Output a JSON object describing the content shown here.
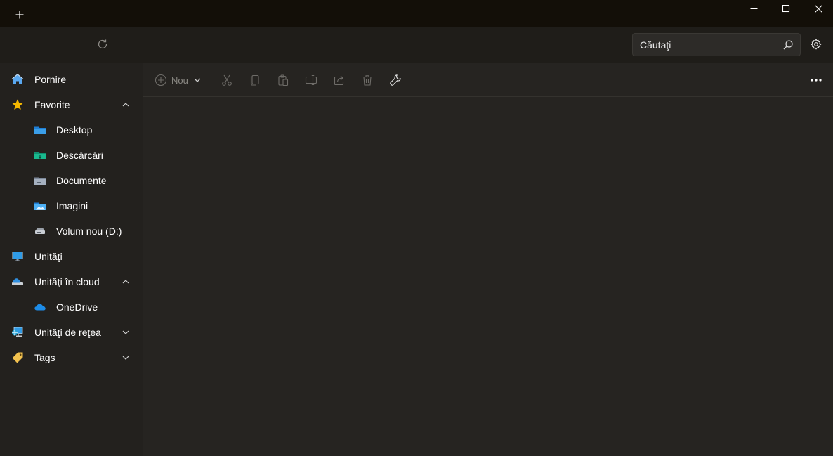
{
  "titlebar": {
    "new_tab_icon": "plus-icon",
    "minimize_icon": "minimize-icon",
    "maximize_icon": "maximize-icon",
    "close_icon": "close-icon"
  },
  "addressbar": {
    "refresh_icon": "refresh-icon",
    "search": {
      "placeholder": "Căutaţi",
      "value": ""
    },
    "settings_icon": "gear-icon"
  },
  "toolbar": {
    "new_label": "Nou",
    "buttons": [
      "cut-icon",
      "copy-icon",
      "paste-icon",
      "rename-icon",
      "share-icon",
      "delete-icon",
      "properties-icon",
      "more-icon"
    ]
  },
  "sidebar": {
    "items": [
      {
        "label": "Pornire",
        "icon": "home-icon"
      },
      {
        "label": "Favorite",
        "icon": "star-icon",
        "expanded": true
      },
      {
        "label": "Desktop",
        "icon": "desktop-folder-icon"
      },
      {
        "label": "Descărcări",
        "icon": "downloads-folder-icon"
      },
      {
        "label": "Documente",
        "icon": "documents-folder-icon"
      },
      {
        "label": "Imagini",
        "icon": "pictures-folder-icon"
      },
      {
        "label": "Volum nou (D:)",
        "icon": "drive-icon"
      },
      {
        "label": "Unităţi",
        "icon": "monitor-icon"
      },
      {
        "label": "Unităţi în cloud",
        "icon": "cloud-drive-icon",
        "expanded": true
      },
      {
        "label": "OneDrive",
        "icon": "onedrive-icon"
      },
      {
        "label": "Unităţi de reţea",
        "icon": "network-icon",
        "expanded": false
      },
      {
        "label": "Tags",
        "icon": "tag-icon",
        "expanded": false
      }
    ]
  },
  "colors": {
    "titlebar_bg": "#130f08",
    "addressbar_bg": "#1f1d19",
    "sidebar_bg": "#23211e",
    "content_bg": "#262421",
    "folder_blue": "#3a9ee8",
    "star_gold": "#f5b800"
  }
}
